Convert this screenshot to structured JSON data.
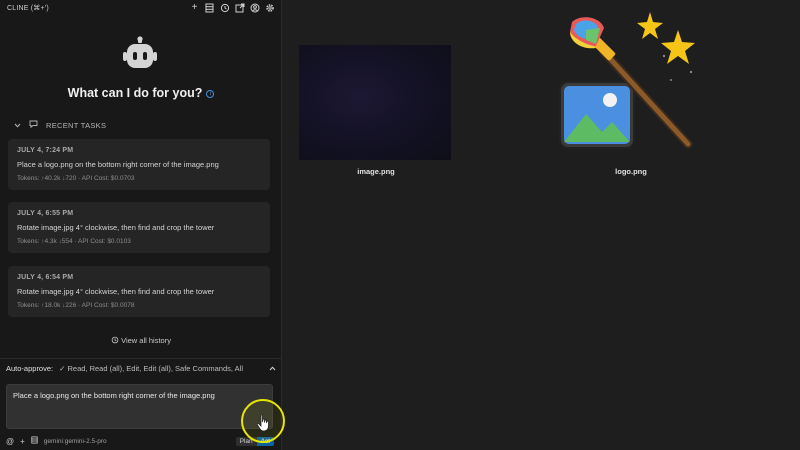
{
  "header": {
    "title": "CLINE (⌘+')",
    "icons": [
      "plus-icon",
      "server-icon",
      "history-icon",
      "popout-icon",
      "account-icon",
      "settings-icon"
    ]
  },
  "welcome": {
    "heading": "What can I do for you?"
  },
  "recent_tasks": {
    "label": "RECENT TASKS",
    "items": [
      {
        "date": "JULY 4, 7:24 PM",
        "text": "Place a logo.png on the bottom right corner of the image.png",
        "meta": "Tokens: ↑40.2k ↓720 · API Cost: $0.0703"
      },
      {
        "date": "JULY 4, 6:55 PM",
        "text": "Rotate image.jpg 4° clockwise, then find and crop the tower",
        "meta": "Tokens: ↑4.3k ↓554 · API Cost: $0.0103"
      },
      {
        "date": "JULY 4, 6:54 PM",
        "text": "Rotate image.jpg 4° clockwise, then find and crop the tower",
        "meta": "Tokens: ↑18.0k ↓226 · API Cost: $0.0078"
      }
    ]
  },
  "view_history": "View all history",
  "auto_approve": {
    "label": "Auto-approve:",
    "values": "✓ Read, Read (all), Edit, Edit (all), Safe Commands, All"
  },
  "chat": {
    "value": "Place a logo.png on the bottom right corner of the image.png"
  },
  "bottom_bar": {
    "model": "gemini:gemini-2.5-pro",
    "plan": "Plan",
    "act": "Act"
  },
  "files": {
    "image": "image.png",
    "logo": "logo.png"
  },
  "colors": {
    "accent": "#0e639c",
    "background": "#1e1e1e",
    "sidebar": "#181818",
    "cursor_highlight": "#e6e600"
  }
}
